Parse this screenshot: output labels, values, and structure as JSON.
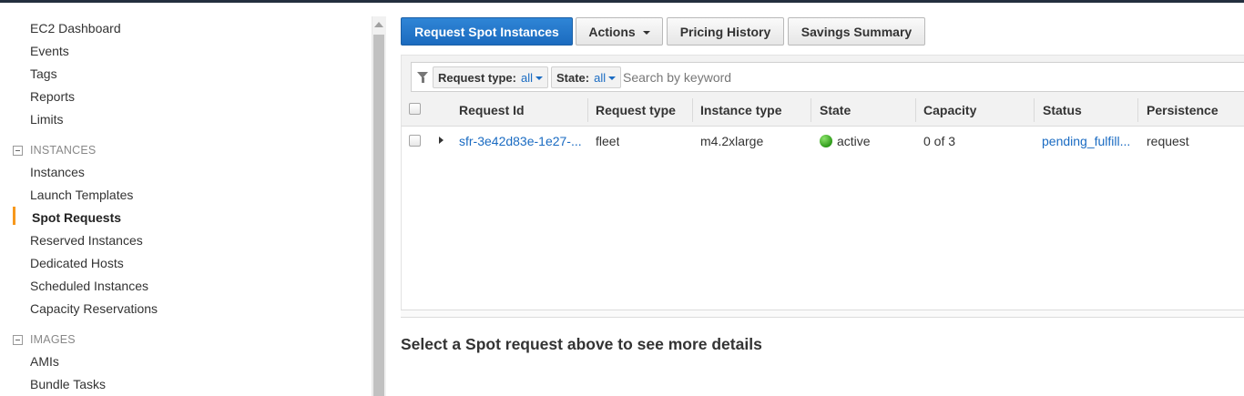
{
  "sidebar": {
    "top_items": [
      {
        "label": "EC2 Dashboard"
      },
      {
        "label": "Events"
      },
      {
        "label": "Tags"
      },
      {
        "label": "Reports"
      },
      {
        "label": "Limits"
      }
    ],
    "instances_section": {
      "heading": "INSTANCES",
      "items": [
        {
          "label": "Instances"
        },
        {
          "label": "Launch Templates"
        },
        {
          "label": "Spot Requests",
          "active": true
        },
        {
          "label": "Reserved Instances"
        },
        {
          "label": "Dedicated Hosts"
        },
        {
          "label": "Scheduled Instances"
        },
        {
          "label": "Capacity Reservations"
        }
      ]
    },
    "images_section": {
      "heading": "IMAGES",
      "items": [
        {
          "label": "AMIs"
        },
        {
          "label": "Bundle Tasks"
        }
      ]
    }
  },
  "toolbar": {
    "request_spot": "Request Spot Instances",
    "actions": "Actions",
    "pricing_history": "Pricing History",
    "savings_summary": "Savings Summary"
  },
  "filter": {
    "request_type_label": "Request type:",
    "request_type_value": "all",
    "state_label": "State:",
    "state_value": "all",
    "search_placeholder": "Search by keyword"
  },
  "table": {
    "columns": [
      "Request Id",
      "Request type",
      "Instance type",
      "State",
      "Capacity",
      "Status",
      "Persistence"
    ],
    "rows": [
      {
        "request_id": "sfr-3e42d83e-1e27-...",
        "request_type": "fleet",
        "instance_type": "m4.2xlarge",
        "state": "active",
        "capacity": "0 of 3",
        "status": "pending_fulfill...",
        "persistence": "request"
      }
    ]
  },
  "details": {
    "placeholder": "Select a Spot request above to see more details"
  },
  "colors": {
    "accent_orange": "#f7981d",
    "primary_blue": "#1b6bbf",
    "link_blue": "#1a6bc2",
    "active_green": "#2e9a1a"
  }
}
